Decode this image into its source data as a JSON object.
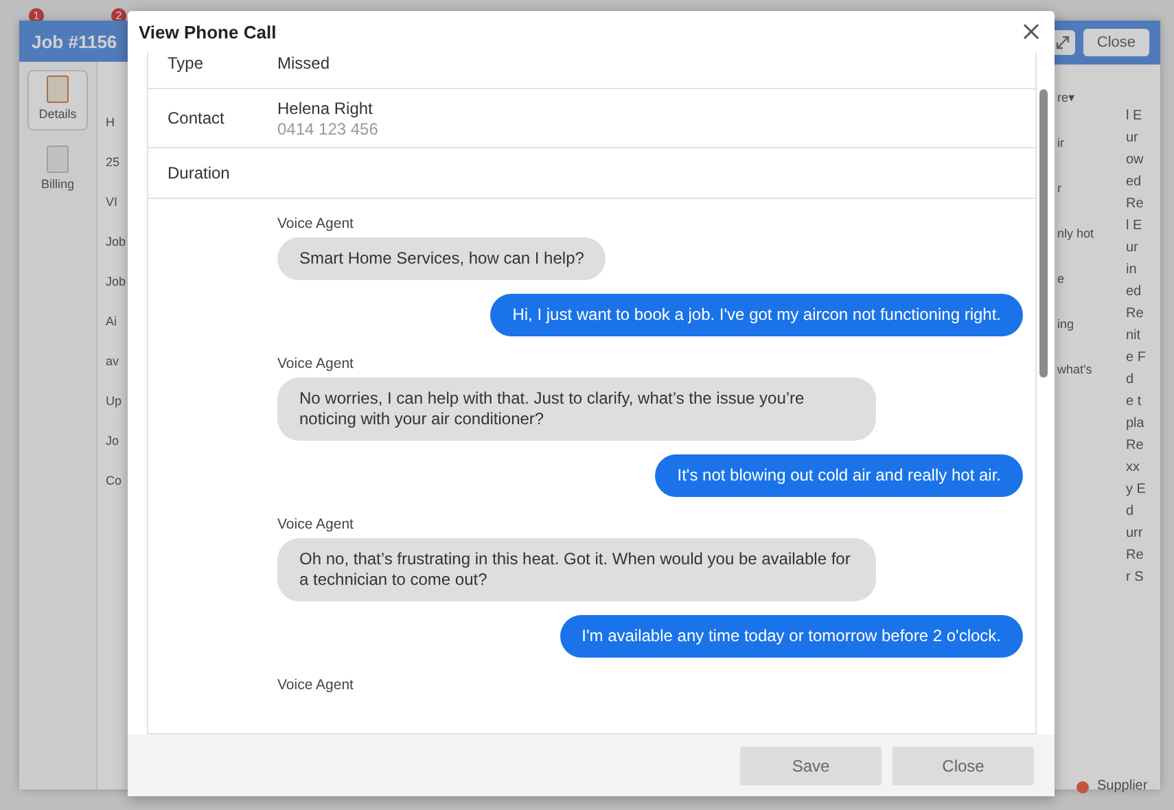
{
  "background": {
    "job_window": {
      "title": "Job #1156",
      "tabs": [
        {
          "label": "Details",
          "selected": true
        },
        {
          "label": "Billing",
          "selected": false
        }
      ],
      "fragments": [
        "H",
        "25",
        "VI",
        "Job",
        "Job",
        "Ai",
        "av",
        "Up",
        "Jo",
        "Co"
      ]
    },
    "side_window": {
      "button": "Close",
      "menu": "re▾",
      "fragments": [
        "ir",
        "r",
        "nly hot",
        "e",
        "ing",
        "what's"
      ]
    },
    "list_fragments": [
      "l E",
      "ur",
      "ow",
      "ed",
      "Re",
      "l E",
      "ur",
      "in",
      "ed",
      "Re",
      "nit",
      "e F",
      "d",
      "e t",
      "pla",
      "Re",
      "xx",
      "y E",
      "d",
      "urr",
      "Re",
      "r S"
    ],
    "supplier": "Supplier",
    "badges": [
      "1",
      "2"
    ]
  },
  "dialog": {
    "title": "View Phone Call",
    "fields": [
      {
        "label": "Type",
        "value": "Missed"
      },
      {
        "label": "Contact",
        "value": "Helena Right",
        "detail": "0414 123 456"
      },
      {
        "label": "Duration"
      }
    ],
    "messages": [
      {
        "kind": "agent",
        "sender": "Voice Agent",
        "text": "Smart Home Services, how can I help?"
      },
      {
        "kind": "user",
        "text": "Hi, I just want to book a job. I've got my aircon not functioning right."
      },
      {
        "kind": "agent",
        "sender": "Voice Agent",
        "text": "No worries, I can help with that. Just to clarify, what’s the issue you’re noticing with your air conditioner?"
      },
      {
        "kind": "user",
        "text": "It's not blowing out cold air and really hot air."
      },
      {
        "kind": "agent",
        "sender": "Voice Agent",
        "text": "Oh no, that’s frustrating in this heat. Got it. When would you be available for a technician to come out?"
      },
      {
        "kind": "user",
        "text": "I'm available any time today or tomorrow before 2 o'clock."
      },
      {
        "kind": "agent",
        "sender": "Voice Agent"
      }
    ],
    "buttons": [
      "Save",
      "Close"
    ]
  }
}
